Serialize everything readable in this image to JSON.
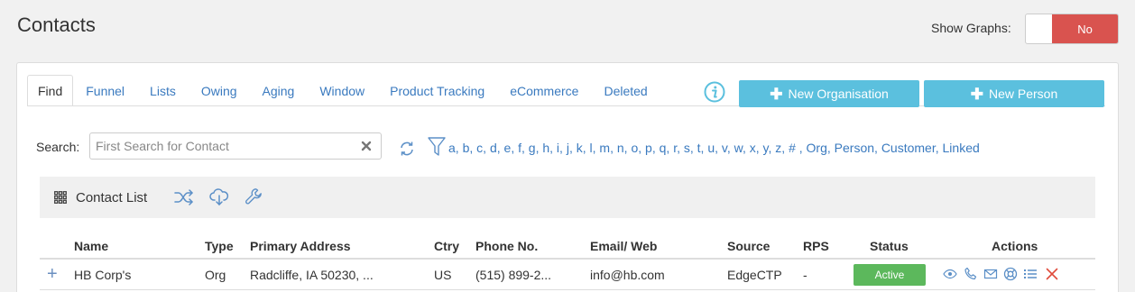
{
  "page": {
    "title": "Contacts"
  },
  "graphs": {
    "label": "Show Graphs:",
    "toggle_value": "No"
  },
  "tabs": [
    {
      "label": "Find",
      "active": true
    },
    {
      "label": "Funnel"
    },
    {
      "label": "Lists"
    },
    {
      "label": "Owing"
    },
    {
      "label": "Aging"
    },
    {
      "label": "Window"
    },
    {
      "label": "Product Tracking"
    },
    {
      "label": "eCommerce"
    },
    {
      "label": "Deleted"
    }
  ],
  "buttons": {
    "new_org": "New Organisation",
    "new_person": "New Person"
  },
  "search": {
    "label": "Search:",
    "placeholder": "First Search for Contact",
    "value": ""
  },
  "filters": [
    "a",
    "b",
    "c",
    "d",
    "e",
    "f",
    "g",
    "h",
    "i",
    "j",
    "k",
    "l",
    "m",
    "n",
    "o",
    "p",
    "q",
    "r",
    "s",
    "t",
    "u",
    "v",
    "w",
    "x",
    "y",
    "z",
    "#",
    "Org",
    "Person",
    "Customer",
    "Linked"
  ],
  "toolbar": {
    "title": "Contact List"
  },
  "table": {
    "columns": [
      "Name",
      "Type",
      "Primary Address",
      "Ctry",
      "Phone No.",
      "Email/ Web",
      "Source",
      "RPS",
      "Status",
      "Actions"
    ],
    "rows": [
      {
        "name": "HB Corp's",
        "type": "Org",
        "address": "Radcliffe, IA 50230, ...",
        "ctry": "US",
        "phone": "(515) 899-2...",
        "email": "info@hb.com",
        "source": "EdgeCTP",
        "rps": "-",
        "status": "Active"
      }
    ]
  },
  "colors": {
    "accent": "#5bc0de",
    "link": "#3a7abf",
    "toggle_off": "#d9534f",
    "status_active": "#5cb85c",
    "delete": "#e04c3c"
  },
  "icons": [
    "info-icon",
    "plus-icon",
    "clear-icon",
    "refresh-icon",
    "filter-icon",
    "grid-icon",
    "shuffle-icon",
    "cloud-download-icon",
    "wrench-icon",
    "expand-plus-icon",
    "eye-icon",
    "phone-icon",
    "envelope-icon",
    "lifebuoy-icon",
    "list-icon",
    "delete-icon"
  ]
}
